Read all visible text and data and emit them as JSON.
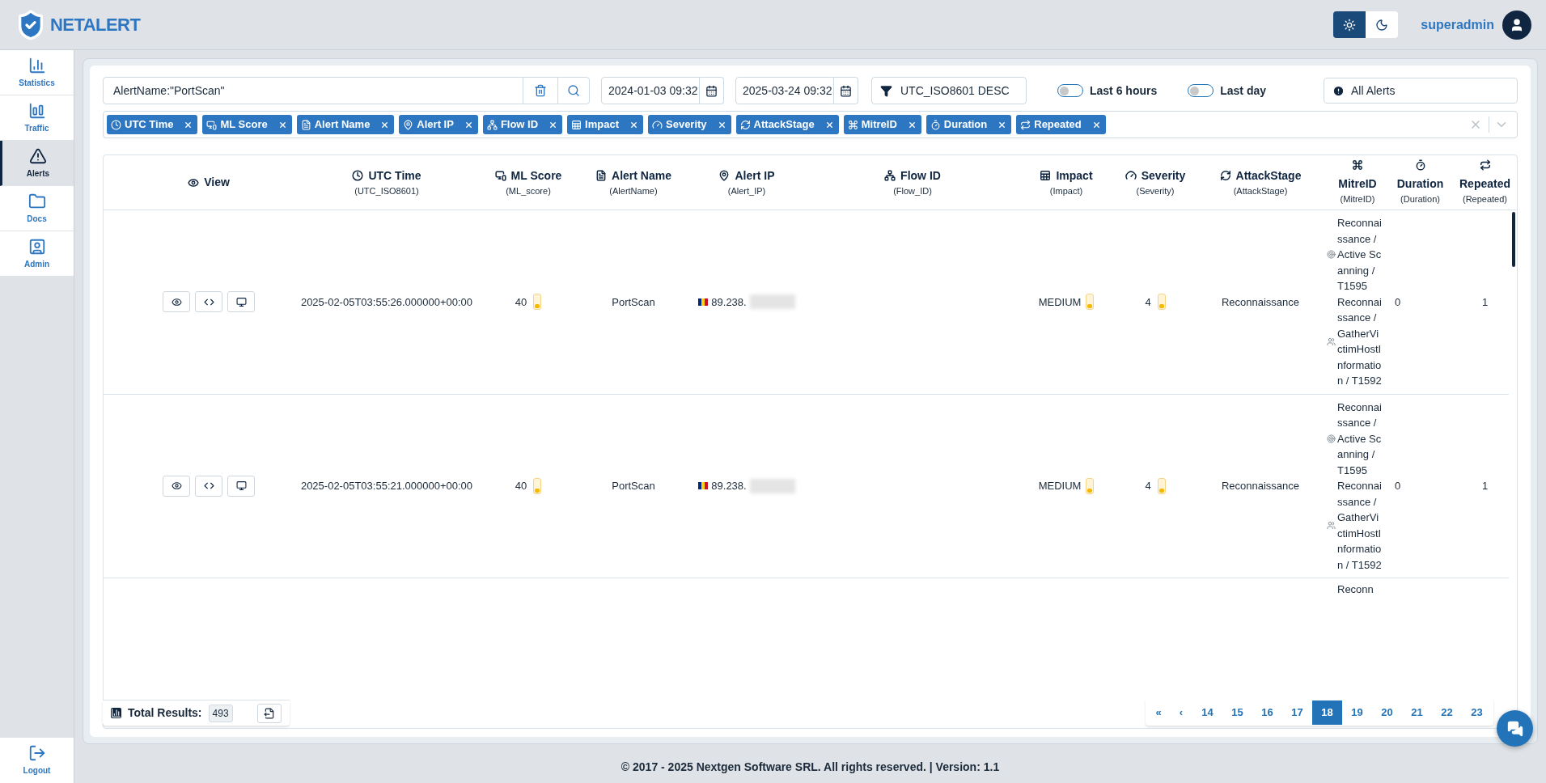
{
  "brand": {
    "name": "NETALERT"
  },
  "theme_toggle": [
    {
      "kind": "light",
      "selected": true
    },
    {
      "kind": "dark",
      "selected": false
    }
  ],
  "user": {
    "name": "superadmin"
  },
  "sidebar": {
    "items": [
      {
        "label": "Statistics",
        "selected": false
      },
      {
        "label": "Traffic",
        "selected": false
      },
      {
        "label": "Alerts",
        "selected": true
      },
      {
        "label": "Docs",
        "selected": false
      },
      {
        "label": "Admin",
        "selected": false
      }
    ],
    "logout": "Logout"
  },
  "search": {
    "value": "AlertName:\"PortScan\""
  },
  "date_from": {
    "value": "2024-01-03 09:32"
  },
  "date_to": {
    "value": "2025-03-24 09:32"
  },
  "sort": {
    "value": "UTC_ISO8601 DESC"
  },
  "toggles": [
    {
      "label": "Last 6 hours",
      "on": false
    },
    {
      "label": "Last day",
      "on": false
    }
  ],
  "alert_filter": {
    "value": "All Alerts"
  },
  "column_chips": [
    "UTC Time",
    "ML Score",
    "Alert Name",
    "Alert IP",
    "Flow ID",
    "Impact",
    "Severity",
    "AttackStage",
    "MitreID",
    "Duration",
    "Repeated"
  ],
  "table": {
    "columns": [
      {
        "label": "View"
      },
      {
        "label": "UTC Time",
        "field": "(UTC_ISO8601)"
      },
      {
        "label": "ML Score",
        "field": "(ML_score)"
      },
      {
        "label": "Alert Name",
        "field": "(AlertName)"
      },
      {
        "label": "Alert IP",
        "field": "(Alert_IP)"
      },
      {
        "label": "Flow ID",
        "field": "(Flow_ID)"
      },
      {
        "label": "Impact",
        "field": "(Impact)"
      },
      {
        "label": "Severity",
        "field": "(Severity)"
      },
      {
        "label": "AttackStage",
        "field": "(AttackStage)"
      },
      {
        "label": "MitreID",
        "field": "(MitreID)"
      },
      {
        "label": "Duration",
        "field": "(Duration)"
      },
      {
        "label": "Repeated",
        "field": "(Repeated)"
      }
    ],
    "rows": [
      {
        "utc_time": "2025-02-05T03:55:26.000000+00:00",
        "ml_score": {
          "text": "40",
          "level": 0.3
        },
        "alert_name": "PortScan",
        "alert_ip": "89.238.",
        "impact": {
          "text": "MEDIUM",
          "level": 0.3
        },
        "severity": {
          "text": "4",
          "level": 0.3
        },
        "attack_stage": "Reconnaissance",
        "mitre": [
          "Reconnaissance / Active Scanning / T1595",
          "Reconnaissance / GatherVictimHostInformation / T1592"
        ],
        "duration": "0",
        "repeated": "1"
      },
      {
        "utc_time": "2025-02-05T03:55:21.000000+00:00",
        "ml_score": {
          "text": "40",
          "level": 0.3
        },
        "alert_name": "PortScan",
        "alert_ip": "89.238.",
        "impact": {
          "text": "MEDIUM",
          "level": 0.3
        },
        "severity": {
          "text": "4",
          "level": 0.3
        },
        "attack_stage": "Reconnaissance",
        "mitre": [
          "Reconnaissance / Active Scanning / T1595",
          "Reconnaissance / GatherVictimHostInformation / T1592"
        ],
        "duration": "0",
        "repeated": "1"
      }
    ],
    "partial_row": {
      "mitre": "Reconn"
    }
  },
  "total_results": {
    "label": "Total Results:",
    "count": "493"
  },
  "pagination": [
    {
      "label": "«",
      "selected": false
    },
    {
      "label": "‹",
      "selected": false
    },
    {
      "label": "14",
      "selected": false
    },
    {
      "label": "15",
      "selected": false
    },
    {
      "label": "16",
      "selected": false
    },
    {
      "label": "17",
      "selected": false
    },
    {
      "label": "18",
      "selected": true
    },
    {
      "label": "19",
      "selected": false
    },
    {
      "label": "20",
      "selected": false
    },
    {
      "label": "21",
      "selected": false
    },
    {
      "label": "22",
      "selected": false
    },
    {
      "label": "23",
      "selected": false
    }
  ],
  "footer": "© 2017 - 2025 Nextgen Software SRL. All rights reserved. | Version: 1.1"
}
